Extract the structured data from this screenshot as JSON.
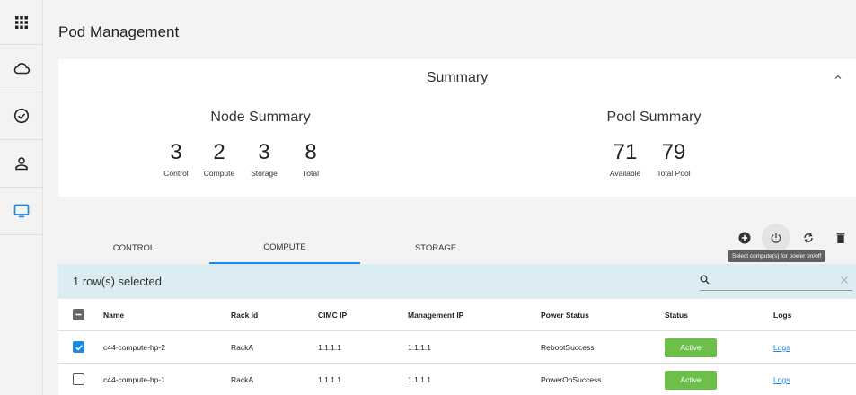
{
  "sidebar": {
    "items": [
      {
        "icon": "apps-grid-icon"
      },
      {
        "icon": "cloud-icon"
      },
      {
        "icon": "check-circle-icon"
      },
      {
        "icon": "person-icon"
      },
      {
        "icon": "monitor-icon"
      }
    ],
    "active_index": 4,
    "accent": "#1e88e5"
  },
  "page": {
    "title": "Pod Management"
  },
  "summary": {
    "title": "Summary",
    "node": {
      "title": "Node Summary",
      "stats": [
        {
          "value": "3",
          "label": "Control"
        },
        {
          "value": "2",
          "label": "Compute"
        },
        {
          "value": "3",
          "label": "Storage"
        },
        {
          "value": "8",
          "label": "Total"
        }
      ]
    },
    "pool": {
      "title": "Pool Summary",
      "stats": [
        {
          "value": "71",
          "label": "Available"
        },
        {
          "value": "79",
          "label": "Total Pool"
        }
      ]
    }
  },
  "toolbar": {
    "tooltip": "Select compute(s) for power on/off"
  },
  "tabs": [
    {
      "label": "CONTROL",
      "active": false
    },
    {
      "label": "COMPUTE",
      "active": true
    },
    {
      "label": "STORAGE",
      "active": false
    }
  ],
  "selection": {
    "text": "1 row(s) selected"
  },
  "search": {
    "placeholder": "",
    "value": ""
  },
  "table": {
    "columns": [
      "Name",
      "Rack Id",
      "CIMC IP",
      "Management IP",
      "Power Status",
      "Status",
      "Logs"
    ],
    "rows": [
      {
        "checked": true,
        "name": "c44-compute-hp-2",
        "rack": "RackA",
        "cimc": "1.1.1.1",
        "mgmt": "1.1.1.1",
        "power": "RebootSuccess",
        "status": "Active",
        "logs": "Logs"
      },
      {
        "checked": false,
        "name": "c44-compute-hp-1",
        "rack": "RackA",
        "cimc": "1.1.1.1",
        "mgmt": "1.1.1.1",
        "power": "PowerOnSuccess",
        "status": "Active",
        "logs": "Logs"
      }
    ]
  },
  "colors": {
    "status_active": "#6cc04a",
    "selection_bar": "#dcecf3",
    "link": "#1e88e5"
  }
}
